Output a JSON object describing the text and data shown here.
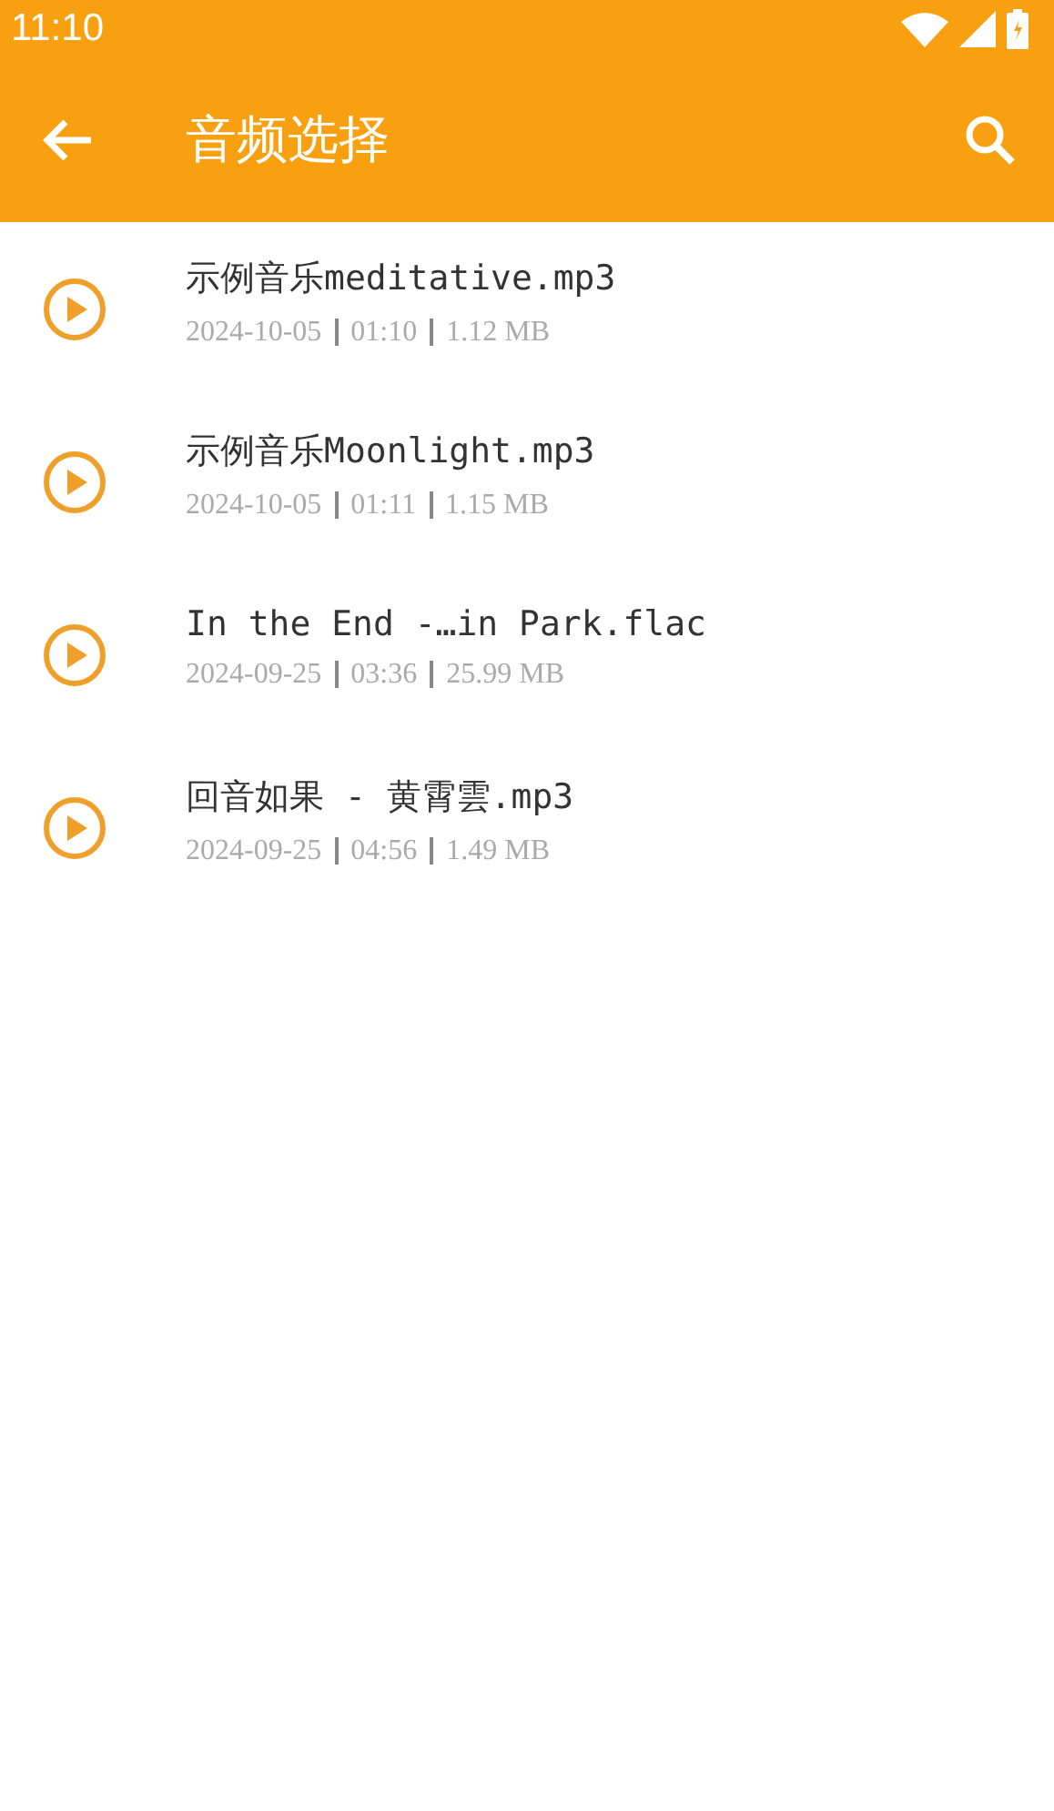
{
  "status_bar": {
    "time": "11:10"
  },
  "toolbar": {
    "title": "音频选择"
  },
  "files": [
    {
      "name": "示例音乐meditative.mp3",
      "date": "2024-10-05",
      "duration": "01:10",
      "size": "1.12 MB"
    },
    {
      "name": "示例音乐Moonlight.mp3",
      "date": "2024-10-05",
      "duration": "01:11",
      "size": "1.15 MB"
    },
    {
      "name": "In the End -…in Park.flac",
      "date": "2024-09-25",
      "duration": "03:36",
      "size": "25.99 MB"
    },
    {
      "name": "回音如果 - 黄霄雲.mp3",
      "date": "2024-09-25",
      "duration": "04:56",
      "size": "1.49 MB"
    }
  ]
}
